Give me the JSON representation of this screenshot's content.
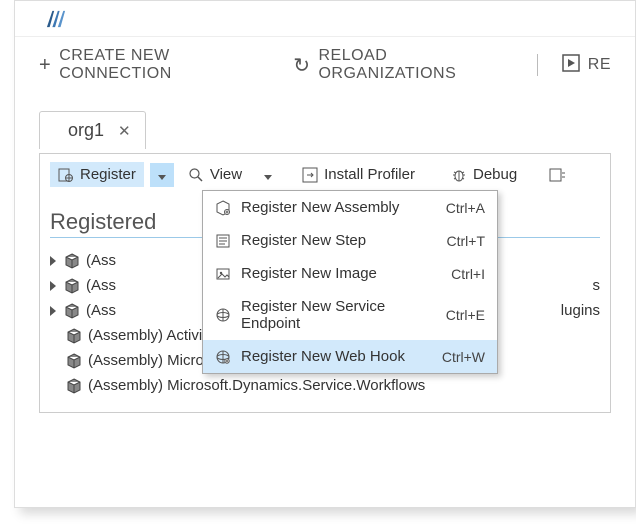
{
  "main_toolbar": {
    "create_connection": "CREATE NEW CONNECTION",
    "reload_orgs": "RELOAD ORGANIZATIONS",
    "re_partial": "RE"
  },
  "tab": {
    "label": "org1"
  },
  "toolbar2": {
    "register": "Register",
    "view": "View",
    "install_profiler": "Install Profiler",
    "debug": "Debug"
  },
  "heading": "Registered",
  "tree": [
    {
      "label": "(Ass",
      "expandable": true
    },
    {
      "label": "(Ass",
      "expandable": true,
      "suffix": "s"
    },
    {
      "label": "(Ass",
      "expandable": true,
      "suffix": "lugins"
    },
    {
      "label": "(Assembly) ActivityAnalysisPlugins.Merged",
      "expandable": false
    },
    {
      "label": "(Assembly) Microsoft.Dynamics.CRMExtensions.Plugins",
      "expandable": false
    },
    {
      "label": "(Assembly) Microsoft.Dynamics.Service.Workflows",
      "expandable": false
    }
  ],
  "dropdown": [
    {
      "label": "Register New Assembly",
      "shortcut": "Ctrl+A",
      "icon": "assembly"
    },
    {
      "label": "Register New Step",
      "shortcut": "Ctrl+T",
      "icon": "step"
    },
    {
      "label": "Register New Image",
      "shortcut": "Ctrl+I",
      "icon": "image"
    },
    {
      "label": "Register New Service Endpoint",
      "shortcut": "Ctrl+E",
      "icon": "endpoint"
    },
    {
      "label": "Register New Web Hook",
      "shortcut": "Ctrl+W",
      "icon": "webhook",
      "highlight": true
    }
  ]
}
